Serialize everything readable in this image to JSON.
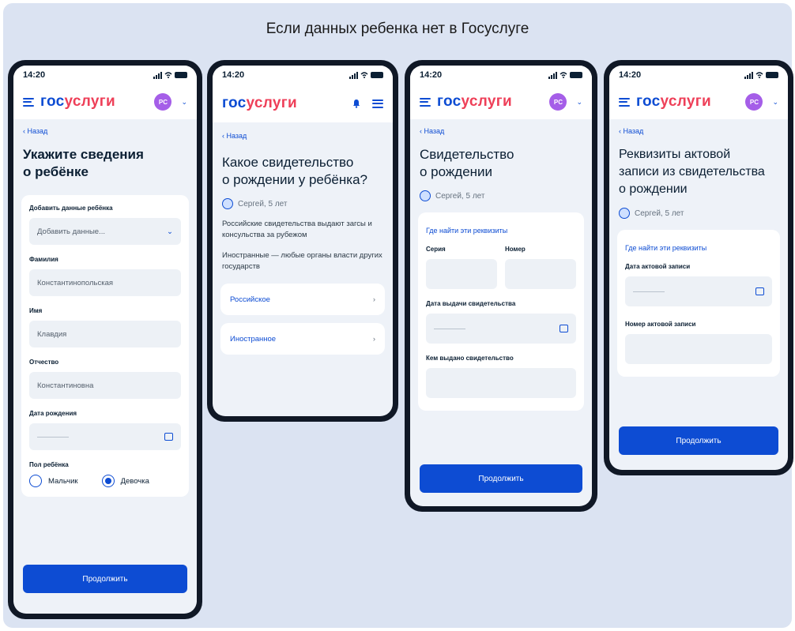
{
  "heading": "Если данных ребенка нет в Госуслуге",
  "common": {
    "time": "14:20",
    "logo_part1": "гос",
    "logo_part2": "услуги",
    "avatar": "PC",
    "back": "‹ Назад",
    "person": "Сергей, 5 лет",
    "continue": "Продолжить",
    "where_find": "Где найти эти реквизиты",
    "colors": {
      "primary": "#0d4cd3",
      "logo_accent": "#ee3f58",
      "avatar": "#a55ee8",
      "background": "#dbe3f2"
    },
    "icons": [
      "menu-icon",
      "calendar-icon",
      "bell-icon",
      "person-icon",
      "chevron-right-icon"
    ]
  },
  "screen1": {
    "title_line1": "Укажите сведения",
    "title_line2": "о ребёнке",
    "add_label": "Добавить данные ребёнка",
    "add_value": "Добавить данные...",
    "surname_label": "Фамилия",
    "surname_value": "Константинопольская",
    "name_label": "Имя",
    "name_value": "Клавдия",
    "patronymic_label": "Отчество",
    "patronymic_value": "Константиновна",
    "birthdate_label": "Дата рождения",
    "gender_label": "Пол ребёнка",
    "gender_male": "Мальчик",
    "gender_female": "Девочка",
    "gender_selected": "Девочка"
  },
  "screen2": {
    "title_line1": "Какое свидетельство",
    "title_line2": "о рождении у ребёнка?",
    "para1": "Российские свидетельства выдают загсы и консульства за рубежом",
    "para2": "Иностранные — любые органы власти других государств",
    "option1": "Российское",
    "option2": "Иностранное"
  },
  "screen3": {
    "title_line1": "Свидетельство",
    "title_line2": "о рождении",
    "series_label": "Серия",
    "number_label": "Номер",
    "issue_date_label": "Дата выдачи свидетельства",
    "issued_by_label": "Кем выдано свидетельство"
  },
  "screen4": {
    "title_line1": "Реквизиты актовой",
    "title_line2": "записи из свидетельства",
    "title_line3": "о рождении",
    "record_date_label": "Дата актовой записи",
    "record_number_label": "Номер актовой записи"
  }
}
